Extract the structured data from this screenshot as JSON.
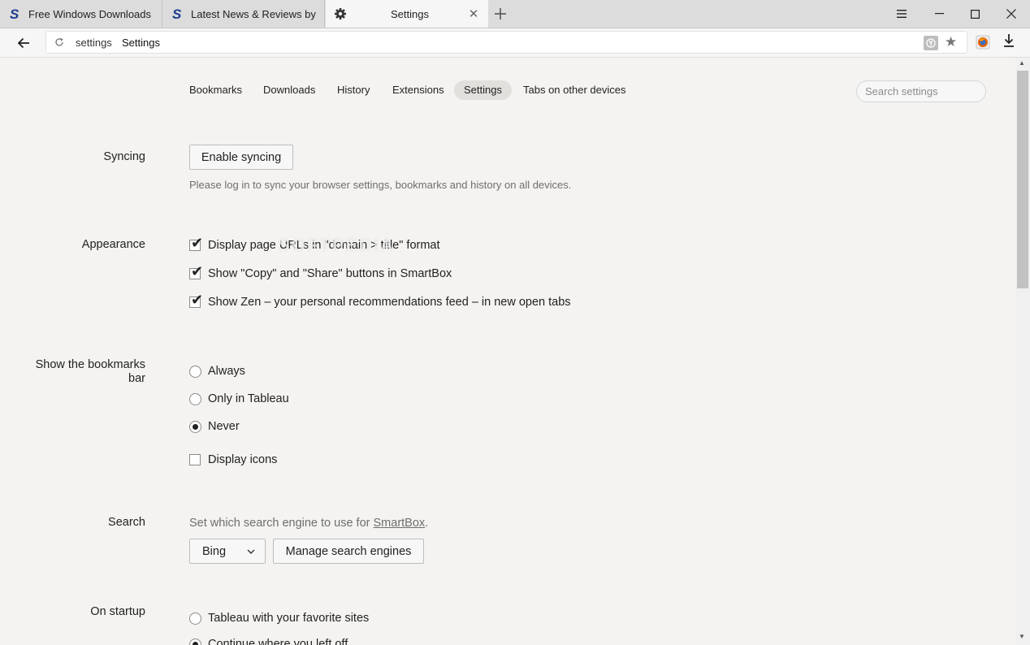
{
  "tabs": [
    {
      "label": "Free Windows Downloads",
      "icon": "softpedia-s-icon"
    },
    {
      "label": "Latest News & Reviews by Sc",
      "icon": "softpedia-s-icon"
    },
    {
      "label": "Settings",
      "icon": "gear-icon",
      "active": true
    }
  ],
  "omnibox": {
    "proto": "settings",
    "title": "Settings"
  },
  "subnav": [
    "Bookmarks",
    "Downloads",
    "History",
    "Extensions",
    "Settings",
    "Tabs on other devices"
  ],
  "search": {
    "placeholder": "Search settings"
  },
  "syncing": {
    "label": "Syncing",
    "button": "Enable syncing",
    "desc": "Please log in to sync your browser settings, bookmarks and history on all devices."
  },
  "appearance": {
    "label": "Appearance",
    "options": [
      {
        "text": "Display page URLs in \"domain > title\" format",
        "checked": true
      },
      {
        "text": "Show \"Copy\" and \"Share\" buttons in SmartBox",
        "checked": true
      },
      {
        "text": "Show Zen – your personal recommendations feed – in new open tabs",
        "checked": true
      }
    ]
  },
  "bookmarks_bar": {
    "label_line1": "Show the bookmarks",
    "label_line2": "bar",
    "options": [
      {
        "text": "Always",
        "selected": false
      },
      {
        "text": "Only in Tableau",
        "selected": false
      },
      {
        "text": "Never",
        "selected": true
      }
    ],
    "display_icons": {
      "text": "Display icons",
      "checked": false
    }
  },
  "search_section": {
    "label": "Search",
    "desc_prefix": "Set which search engine to use for ",
    "desc_link": "SmartBox",
    "desc_suffix": ".",
    "engine": "Bing",
    "manage": "Manage search engines"
  },
  "startup": {
    "label": "On startup",
    "options": [
      {
        "text": "Tableau with your favorite sites",
        "selected": false
      },
      {
        "text": "Continue where you left off",
        "selected": true
      }
    ]
  },
  "watermark": "SOFTPEDIA"
}
